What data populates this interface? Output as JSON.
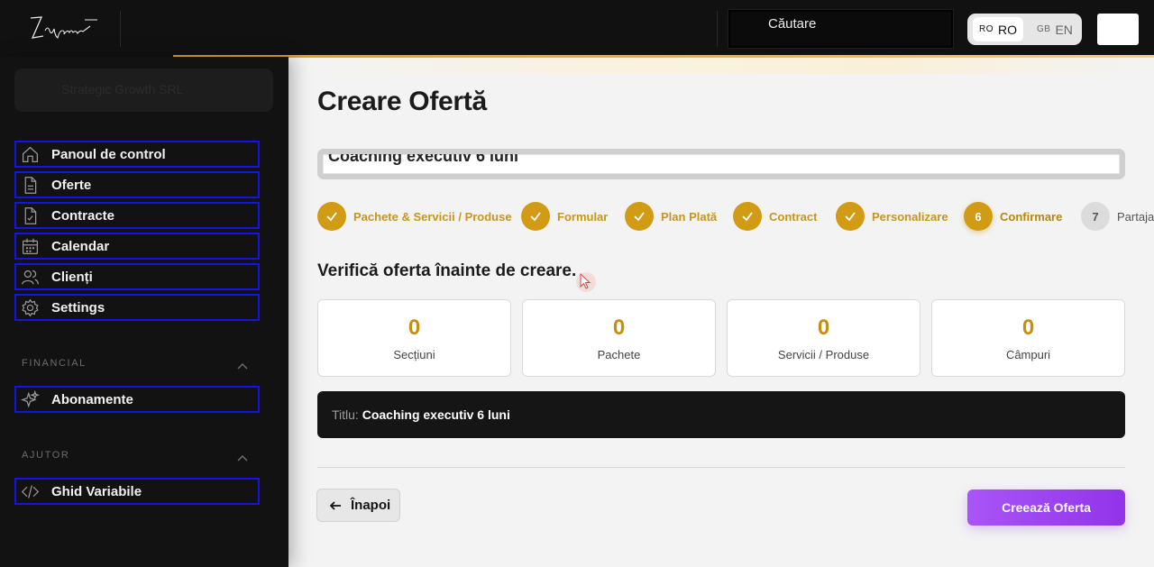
{
  "topbar": {
    "logo_text": "Zapiesio",
    "search_label": "Căutare",
    "languages": [
      {
        "code": "RO",
        "label": "RO",
        "active": true
      },
      {
        "code": "GB",
        "label": "EN",
        "active": false
      }
    ]
  },
  "sidebar": {
    "organization": "Strategic Growth SRL",
    "items": [
      {
        "label": "Panoul de control",
        "icon": "home-icon"
      },
      {
        "label": "Oferte",
        "icon": "document-icon"
      },
      {
        "label": "Contracte",
        "icon": "signed-document-icon"
      },
      {
        "label": "Calendar",
        "icon": "calendar-icon"
      },
      {
        "label": "Clienți",
        "icon": "users-icon"
      },
      {
        "label": "Settings",
        "icon": "gear-icon"
      }
    ],
    "sections": [
      {
        "title": "FINANCIAL",
        "items": [
          {
            "label": "Abonamente",
            "icon": "sparkles-icon"
          }
        ]
      },
      {
        "title": "AJUTOR",
        "items": [
          {
            "label": "Ghid Variabile",
            "icon": "code-icon"
          }
        ]
      }
    ]
  },
  "main": {
    "page_title": "Creare Ofertă",
    "offer_title_value": "Coaching executiv 6 luni",
    "steps": [
      {
        "label": "Pachete & Servicii / Produse",
        "state": "done"
      },
      {
        "label": "Formular",
        "state": "done"
      },
      {
        "label": "Plan Plată",
        "state": "done"
      },
      {
        "label": "Contract",
        "state": "done"
      },
      {
        "label": "Personalizare",
        "state": "done"
      },
      {
        "label": "Confirmare",
        "state": "current",
        "number": "6"
      },
      {
        "label": "Partajare",
        "state": "todo",
        "number": "7"
      }
    ],
    "verify_heading": "Verifică oferta înainte de creare.",
    "stats": [
      {
        "value": "0",
        "label": "Secțiuni"
      },
      {
        "value": "0",
        "label": "Pachete"
      },
      {
        "value": "0",
        "label": "Servicii / Produse"
      },
      {
        "value": "0",
        "label": "Câmpuri"
      }
    ],
    "summary": {
      "key": "Titlu:",
      "value": "Coaching executiv 6 luni"
    },
    "back_label": "Înapoi",
    "create_label": "Creează Oferta"
  },
  "colors": {
    "accent_gold": "#d19b16",
    "primary_purple": "#9333ea",
    "sidebar_bg": "#121212",
    "nav_outline": "#1414e6"
  }
}
